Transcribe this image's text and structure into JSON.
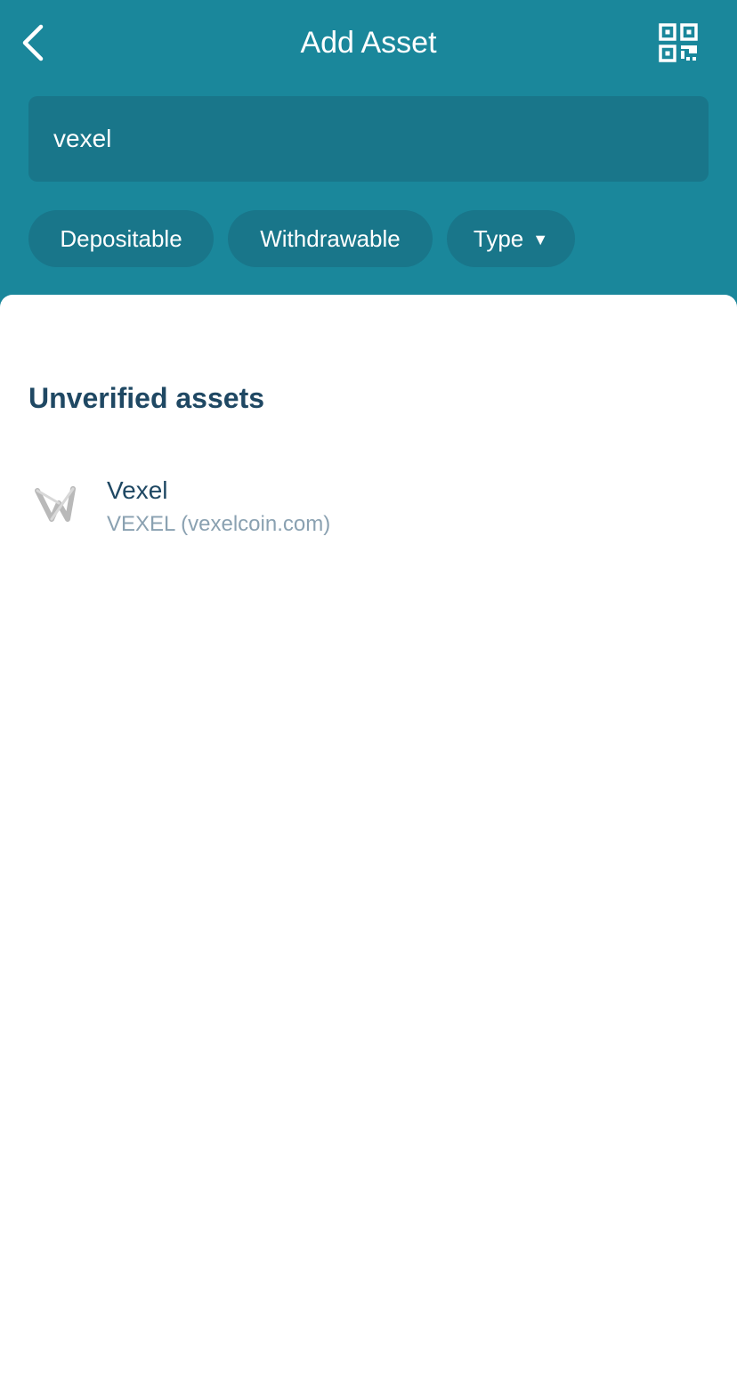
{
  "header": {
    "title": "Add Asset",
    "back_icon": "chevron-left-icon",
    "qr_icon": "qr-code-icon"
  },
  "search": {
    "value": "vexel"
  },
  "filters": {
    "depositable": "Depositable",
    "withdrawable": "Withdrawable",
    "type": "Type",
    "type_caret": "▼"
  },
  "section": {
    "title": "Unverified assets"
  },
  "assets": [
    {
      "name": "Vexel",
      "subtitle": "VEXEL (vexelcoin.com)",
      "icon": "vexel-logo-icon"
    }
  ],
  "colors": {
    "header_bg": "#1a879b",
    "field_bg": "#19768a",
    "title_text": "#1f4863",
    "muted_text": "#8aa1b1"
  }
}
